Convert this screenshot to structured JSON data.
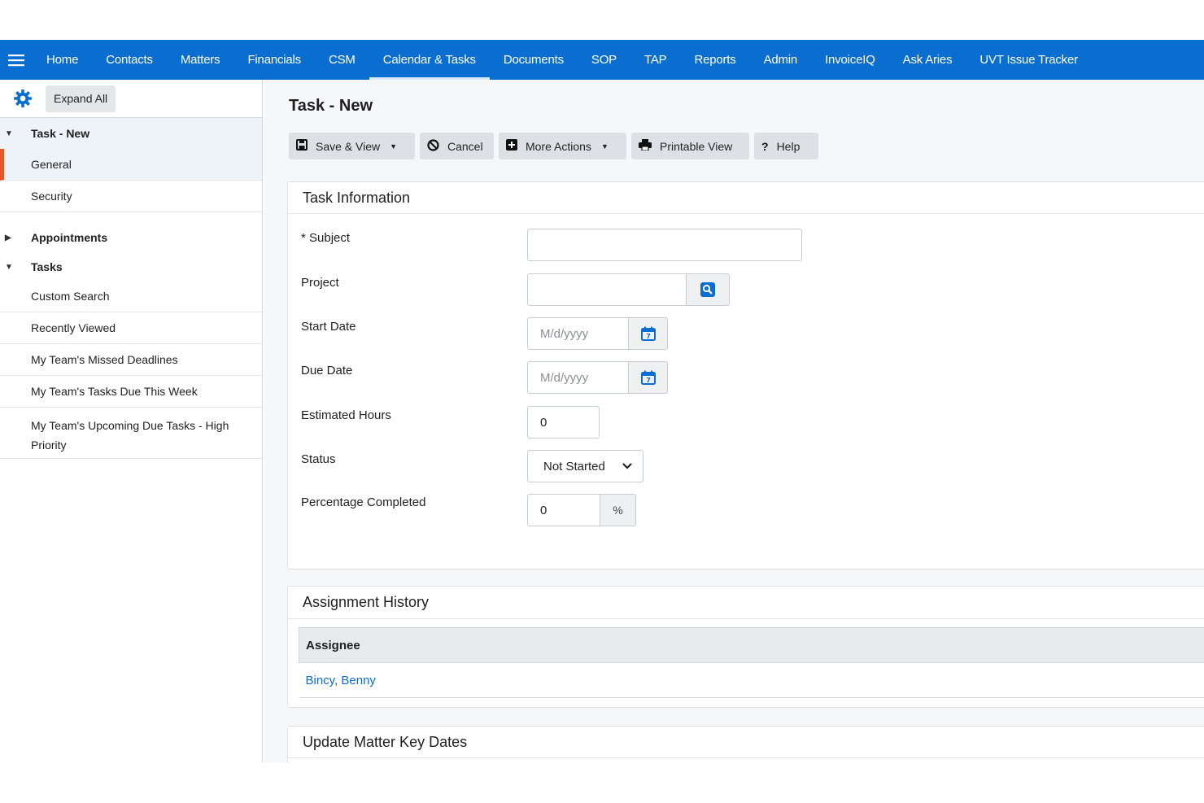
{
  "nav": {
    "menu_icon": "hamburger-icon",
    "items": [
      {
        "label": "Home"
      },
      {
        "label": "Contacts"
      },
      {
        "label": "Matters"
      },
      {
        "label": "Financials"
      },
      {
        "label": "CSM"
      },
      {
        "label": "Calendar & Tasks",
        "active": true
      },
      {
        "label": "Documents"
      },
      {
        "label": "SOP"
      },
      {
        "label": "TAP"
      },
      {
        "label": "Reports"
      },
      {
        "label": "Admin"
      },
      {
        "label": "InvoiceIQ"
      },
      {
        "label": "Ask Aries"
      },
      {
        "label": "UVT Issue Tracker"
      }
    ]
  },
  "sidebar": {
    "expand_all": "Expand All",
    "task_group": "Task - New",
    "task_items": [
      "General",
      "Security"
    ],
    "appointments": "Appointments",
    "tasks_group": "Tasks",
    "tasks_items": [
      "Custom Search",
      "Recently Viewed",
      "My Team's Missed Deadlines",
      "My Team's Tasks Due This Week",
      "My Team's Upcoming Due Tasks - High Priority"
    ]
  },
  "page": {
    "title": "Task - New",
    "toolbar": {
      "save_view": "Save & View",
      "cancel": "Cancel",
      "more_actions": "More Actions",
      "printable_view": "Printable View",
      "help": "Help"
    }
  },
  "task_info": {
    "heading": "Task Information",
    "subject_label": "* Subject",
    "subject_value": "",
    "project_label": "Project",
    "project_value": "",
    "start_date_label": "Start Date",
    "start_date_placeholder": "M/d/yyyy",
    "due_date_label": "Due Date",
    "due_date_placeholder": "M/d/yyyy",
    "estimated_hours_label": "Estimated Hours",
    "estimated_hours_value": "0",
    "status_label": "Status",
    "status_value": "Not Started",
    "percentage_label": "Percentage Completed",
    "percentage_value": "0",
    "percentage_unit": "%"
  },
  "assignment_history": {
    "heading": "Assignment History",
    "column": "Assignee",
    "rows": [
      "Bincy, Benny"
    ]
  },
  "matter_key_dates": {
    "heading": "Update Matter Key Dates"
  },
  "colors": {
    "nav_bg": "#0a6ed1",
    "accent_orange": "#e8562a",
    "link_blue": "#0a6ed1"
  }
}
